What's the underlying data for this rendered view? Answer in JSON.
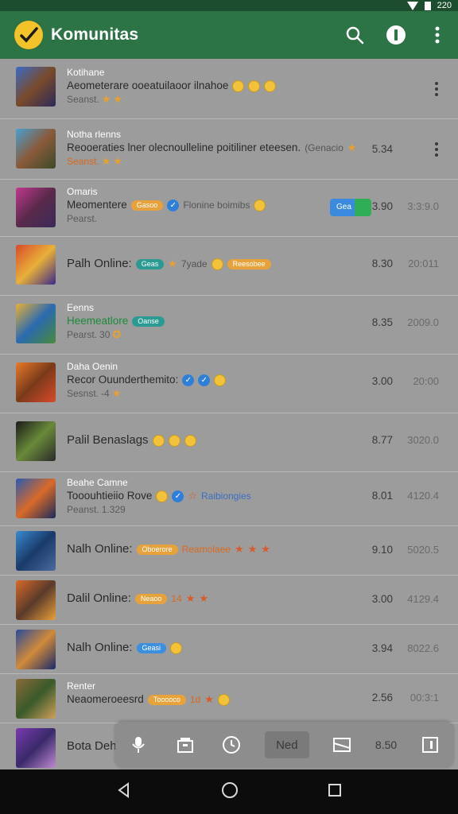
{
  "status": {
    "time": "220"
  },
  "appbar": {
    "title": "Komunitas",
    "icons": [
      "search-icon",
      "info-icon",
      "more-vert-icon"
    ]
  },
  "rows": [
    {
      "name": "Kotihane",
      "line": "Aeometerare ooeatuilaoor ilnahoe",
      "sub": "Seanst.",
      "time": "",
      "date": ""
    },
    {
      "name": "Notha rlenns",
      "line": "Reooeraties lner olecnoulleline poitiliner eteesen.",
      "line_extra": "(Genacio",
      "sub": "Seanst.",
      "time": "5.34",
      "date": ""
    },
    {
      "name": "Omaris",
      "line": "Meomentere",
      "pill": "Gasoo",
      "line_extra": "Flonine boimibs",
      "sub": "Pearst.",
      "toggle": "Gea",
      "time": "3.90",
      "date": "3:3:9.0"
    },
    {
      "name": "",
      "line": "Palh Online:",
      "pill": "Geas",
      "line_extra": "7yade",
      "pill2": "Reesobee",
      "sub": "",
      "time": "8.30",
      "date": "20:011"
    },
    {
      "name": "Eenns",
      "line": "Heemeatlore",
      "pill": "Oanse",
      "sub": "Pearst.",
      "sub_extra": "30",
      "time": "8.35",
      "date": "2009.0"
    },
    {
      "name": "Daha Oenin",
      "line": "Recor Ouunderthemito:",
      "sub": "Sesnst.",
      "sub_extra": "-4",
      "time": "3.00",
      "date": "20:00"
    },
    {
      "name": "",
      "line": "Palil Benaslags",
      "sub": "",
      "time": "8.77",
      "date": "3020.0"
    },
    {
      "name": "Beahe Camne",
      "line": "Tooouhtieiio Rove",
      "line_extra": "Raibiongies",
      "sub": "Peanst.",
      "sub_extra": "1.329",
      "time": "8.01",
      "date": "4120.4"
    },
    {
      "name": "",
      "line": "Nalh Online:",
      "pill": "Oboerore",
      "line_extra": "Reamolaee",
      "sub": "",
      "time": "9.10",
      "date": "5020.5"
    },
    {
      "name": "",
      "line": "Dalil Online:",
      "pill": "Neaoo",
      "line_extra": "14",
      "sub": "",
      "time": "3.00",
      "date": "4129.4"
    },
    {
      "name": "",
      "line": "Nalh Online:",
      "pill": "Geasi",
      "sub": "",
      "time": "3.94",
      "date": "8022.6"
    },
    {
      "name": "Renter",
      "line": "Neaomeroeesrd",
      "pill": "Tooooco",
      "line_extra": "1d",
      "sub": "",
      "time": "2.56",
      "date": "00:3:1"
    },
    {
      "name": "",
      "line": "Bota Dehr",
      "sub": "",
      "time": "",
      "date": ""
    }
  ],
  "toolbar": {
    "tab_label": "Ned",
    "badge_value": "8.50"
  }
}
